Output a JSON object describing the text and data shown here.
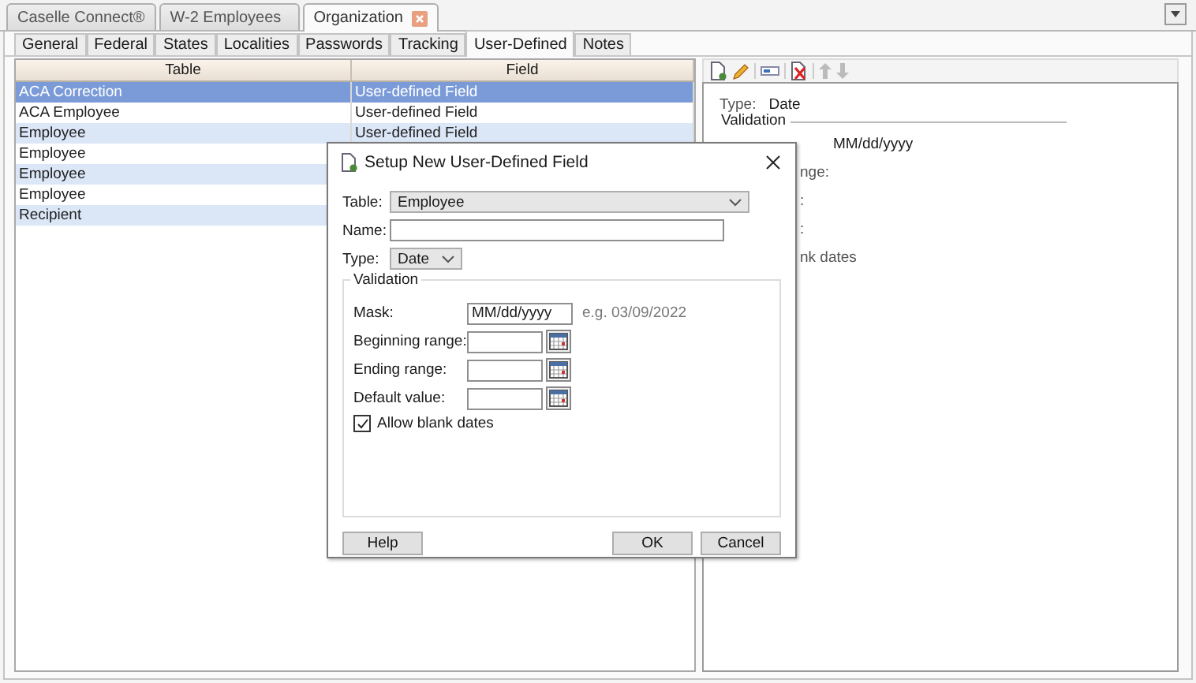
{
  "doc_tabs": [
    {
      "label": "Caselle Connect®",
      "selected": false,
      "closable": false
    },
    {
      "label": "W-2 Employees",
      "selected": false,
      "closable": false
    },
    {
      "label": "Organization",
      "selected": true,
      "closable": true
    }
  ],
  "sub_tabs": [
    {
      "label": "General",
      "selected": false
    },
    {
      "label": "Federal",
      "selected": false
    },
    {
      "label": "States",
      "selected": false
    },
    {
      "label": "Localities",
      "selected": false
    },
    {
      "label": "Passwords",
      "selected": false
    },
    {
      "label": "Tracking",
      "selected": false
    },
    {
      "label": "User-Defined",
      "selected": true
    },
    {
      "label": "Notes",
      "selected": false
    }
  ],
  "table": {
    "columns": [
      "Table",
      "Field"
    ],
    "rows": [
      {
        "table": "ACA Correction",
        "field": "User-defined Field",
        "selected": true
      },
      {
        "table": "ACA Employee",
        "field": "User-defined Field",
        "selected": false
      },
      {
        "table": "Employee",
        "field": "User-defined Field",
        "selected": false
      },
      {
        "table": "Employee",
        "selected": false
      },
      {
        "table": "Employee",
        "selected": false
      },
      {
        "table": "Employee",
        "selected": false
      },
      {
        "table": "Recipient",
        "selected": false
      }
    ]
  },
  "detail": {
    "type_label": "Type:",
    "type_value": "Date",
    "group_title": "Validation",
    "rows": [
      {
        "value": "MM/dd/yyyy"
      },
      {
        "label_fragment": "nge:"
      },
      {
        "label_fragment": ":"
      },
      {
        "label_fragment": ":"
      },
      {
        "label_fragment": "nk dates"
      }
    ]
  },
  "dialog": {
    "title": "Setup New User-Defined Field",
    "table_label": "Table:",
    "table_value": "Employee",
    "name_label": "Name:",
    "type_label": "Type:",
    "type_value": "Date",
    "validation": {
      "title": "Validation",
      "mask_label": "Mask:",
      "mask_value": "MM/dd/yyyy",
      "mask_example": "e.g. 03/09/2022",
      "ranges": [
        {
          "label": "Beginning range:"
        },
        {
          "label": "Ending range:"
        },
        {
          "label": "Default value:"
        }
      ],
      "allow_blank": {
        "label": "Allow blank dates",
        "checked": true
      }
    },
    "buttons": [
      "Help",
      "OK",
      "Cancel"
    ]
  }
}
